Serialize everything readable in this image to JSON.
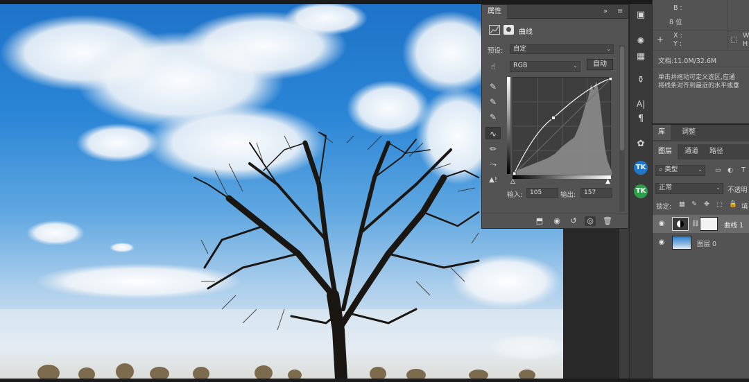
{
  "properties": {
    "tab_label": "属性",
    "expand_glyph": "»",
    "menu_glyph": "≡",
    "adjustment_label": "曲线",
    "preset_label": "预设:",
    "preset_value": "自定",
    "channel_value": "RGB",
    "auto_button": "自动",
    "input_label": "输入:",
    "input_value": "105",
    "output_label": "输出:",
    "output_value": "157"
  },
  "info_panel": {
    "b_label": "B :",
    "bits": "8 位",
    "x_label": "X :",
    "y_label": "Y :",
    "w_label": "W",
    "h_label": "H",
    "doc_size": "文档:11.0M/32.6M",
    "hint_line1": "单击并拖动可定义选区,应通",
    "hint_line2": "将线条对齐到最近的水平或垂"
  },
  "library_tabs": [
    "库",
    "调整"
  ],
  "layer_panel": {
    "tabs": [
      "图层",
      "通道",
      "路径"
    ],
    "filter_label": "类型",
    "blend_mode": "正常",
    "opacity_label": "不透明",
    "lock_label": "锁定:",
    "fill_label": "填",
    "layers": [
      {
        "name": "曲线 1",
        "selected": true
      },
      {
        "name": "图层 0",
        "selected": false
      }
    ]
  },
  "colors": {
    "panel_bg": "#535353",
    "tab_bg": "#424242",
    "app_bg": "#262626",
    "tk_blue": "#1f77c9",
    "tk_green": "#2e9e4b"
  },
  "icons": [
    "adjust-icon",
    "layer-mask-icon",
    "targeted-adjust-icon",
    "eyedropper-black-icon",
    "eyedropper-gray-icon",
    "eyedropper-white-icon",
    "curve-point-icon",
    "pencil-icon",
    "smooth-icon",
    "clipping-warning-icon",
    "clip-to-layer-icon",
    "view-previous-icon",
    "reset-icon",
    "visibility-icon",
    "trash-icon"
  ]
}
